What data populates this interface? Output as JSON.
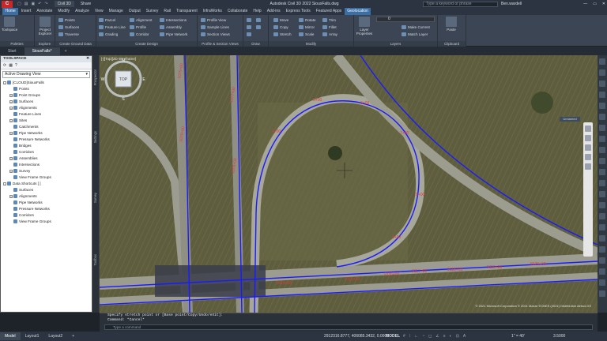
{
  "app": {
    "logo": "C",
    "workspace": "Civil 3D",
    "share_label": "Share",
    "title": "Autodesk Civil 3D 2022   SiouxFalls.dwg",
    "search_placeholder": "Type a keyword or phrase",
    "user": "Ben.wardell"
  },
  "menu_tabs": [
    "Home",
    "Insert",
    "Annotate",
    "Modify",
    "Analyze",
    "View",
    "Manage",
    "Output",
    "Survey",
    "Rail",
    "Transparent",
    "InfraWorks",
    "Collaborate",
    "Help",
    "Add-ins",
    "Express Tools",
    "Featured Apps",
    "Geolocation"
  ],
  "ribbon": {
    "palettes": {
      "big": "Toolspace",
      "title": "Palettes"
    },
    "explore": {
      "big": "Project Explorer",
      "title": "Explore"
    },
    "ground": {
      "items": [
        "Points",
        "Surfaces",
        "Traverse"
      ],
      "title": "Create Ground Data"
    },
    "design": {
      "items": [
        "Parcel",
        "Feature Line",
        "Grading",
        "Alignment",
        "Profile",
        "Corridor",
        "Intersections",
        "Assembly",
        "Pipe Network"
      ],
      "title": "Create Design"
    },
    "profile": {
      "items": [
        "Profile View",
        "Sample Lines",
        "Section Views"
      ],
      "title": "Profile & Section Views"
    },
    "draw": {
      "title": "Draw"
    },
    "modify": {
      "items": [
        "Move",
        "Copy",
        "Stretch",
        "Rotate",
        "Mirror",
        "Scale",
        "Trim",
        "Fillet",
        "Array"
      ],
      "title": "Modify"
    },
    "layers": {
      "big": "Layer Properties",
      "items": [
        "Make Current",
        "Match Layer"
      ],
      "layer_value": "0",
      "title": "Layers"
    },
    "clipboard": {
      "big": "Paste",
      "title": "Clipboard"
    }
  },
  "file_tabs": [
    "Start",
    "SiouxFalls*",
    "+"
  ],
  "toolspace": {
    "title": "TOOLSPACE",
    "view": "Active Drawing View",
    "tree": [
      {
        "label": "[CLOUD]SiouxFalls",
        "depth": 0,
        "box": "-"
      },
      {
        "label": "Points",
        "depth": 1,
        "box": ""
      },
      {
        "label": "Point Groups",
        "depth": 1,
        "box": "+"
      },
      {
        "label": "Surfaces",
        "depth": 1,
        "box": "+"
      },
      {
        "label": "Alignments",
        "depth": 1,
        "box": "+"
      },
      {
        "label": "Feature Lines",
        "depth": 1,
        "box": ""
      },
      {
        "label": "Sites",
        "depth": 1,
        "box": "+"
      },
      {
        "label": "Catchments",
        "depth": 1,
        "box": ""
      },
      {
        "label": "Pipe Networks",
        "depth": 1,
        "box": "+"
      },
      {
        "label": "Pressure Networks",
        "depth": 1,
        "box": ""
      },
      {
        "label": "Bridges",
        "depth": 1,
        "box": ""
      },
      {
        "label": "Corridors",
        "depth": 1,
        "box": ""
      },
      {
        "label": "Assemblies",
        "depth": 1,
        "box": "+"
      },
      {
        "label": "Intersections",
        "depth": 1,
        "box": ""
      },
      {
        "label": "Survey",
        "depth": 1,
        "box": "+"
      },
      {
        "label": "View Frame Groups",
        "depth": 1,
        "box": ""
      },
      {
        "label": "Data Shortcuts [ ]",
        "depth": 0,
        "box": "-"
      },
      {
        "label": "Surfaces",
        "depth": 1,
        "box": ""
      },
      {
        "label": "Alignments",
        "depth": 1,
        "box": "+"
      },
      {
        "label": "Pipe Networks",
        "depth": 1,
        "box": ""
      },
      {
        "label": "Pressure Networks",
        "depth": 1,
        "box": ""
      },
      {
        "label": "Corridors",
        "depth": 1,
        "box": ""
      },
      {
        "label": "View Frame Groups",
        "depth": 1,
        "box": ""
      }
    ]
  },
  "side_tabs": [
    "Prospector",
    "Settings",
    "Survey",
    "Toolbox"
  ],
  "viewport": {
    "label": "[-][Top][2D Wireframe]",
    "cube_face": "TOP",
    "compass": {
      "n": "N",
      "s": "S",
      "e": "E",
      "w": "W"
    },
    "wcs": "Unnamed",
    "copyright": "© 2021 Microsoft Corporation © 2021 Maxar ©CNES (2021) Distribution Airbus DS",
    "stations": [
      "4+00",
      "5+00",
      "6+00",
      "7+00",
      "8+00",
      "9+00",
      "9114+00",
      "9115+00",
      "9116+00",
      "9117+00",
      "9118+00",
      "9119+00",
      "9120+00",
      "1075+00",
      "1076+00",
      "1077+00",
      "1078+00"
    ],
    "colors": {
      "alignment": "#1a1aff",
      "label": "#e03a3a",
      "aerial": "#5e5e3f",
      "road": "#9c9c90"
    }
  },
  "command": {
    "line1": "Specify stretch point or [Base point/Copy/Undo/eXit]:",
    "line2": "Command: *Cancel*",
    "placeholder": "Type a command"
  },
  "status": {
    "layout_tabs": [
      "Model",
      "Layout1",
      "Layout2",
      "+"
    ],
    "coords": "2912316.8777, 406085.3432, 0.0000",
    "model_label": "MODEL",
    "scale": "1\" = 40'",
    "zoom": "3.5000"
  }
}
